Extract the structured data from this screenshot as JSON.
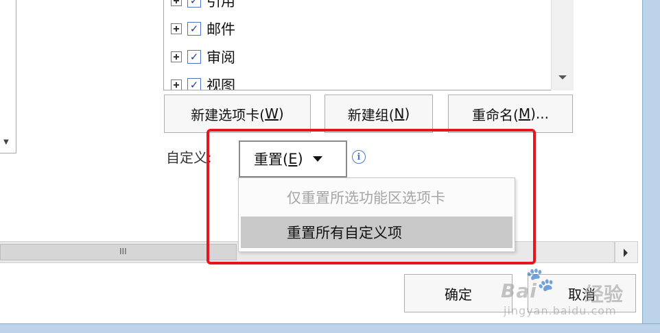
{
  "tree": {
    "items": [
      {
        "label": "引用",
        "checked": true
      },
      {
        "label": "邮件",
        "checked": true
      },
      {
        "label": "审阅",
        "checked": true
      },
      {
        "label": "视图",
        "checked": true
      }
    ],
    "checkmark": "✓"
  },
  "buttons": {
    "new_tab_prefix": "新建选项卡(",
    "new_tab_key": "W",
    "new_tab_suffix": ")",
    "new_group_prefix": "新建组(",
    "new_group_key": "N",
    "new_group_suffix": ")",
    "rename_prefix": "重命名(",
    "rename_key": "M",
    "rename_suffix": ")..."
  },
  "customize": {
    "label": "自定义:",
    "reset_prefix": "重置(",
    "reset_key": "E",
    "reset_suffix": ")",
    "info_glyph": "i"
  },
  "dropdown": {
    "items": [
      {
        "label": "仅重置所选功能区选项卡",
        "enabled": false
      },
      {
        "label": "重置所有自定义项",
        "enabled": true,
        "hovered": true
      }
    ]
  },
  "scrollbar": {
    "grip": "III"
  },
  "footer": {
    "ok_label": "确定",
    "cancel_label": "取消"
  },
  "watermark": {
    "paw": "🐾",
    "brand": "Bai",
    "brand_suffix": "经验",
    "url": "jingyan.baidu.com"
  },
  "colors": {
    "highlight": "#e8141d",
    "checkbox_border": "#4a74c9",
    "hover_bg": "#c8c8c8",
    "disabled_text": "#a5a5a5"
  }
}
